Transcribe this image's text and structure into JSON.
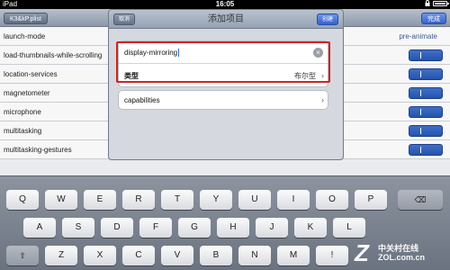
{
  "status_bar": {
    "carrier": "iPad",
    "time": "16:05",
    "wifi_icon": "wifi-icon",
    "lock_icon": "lock-icon",
    "battery_icon": "battery-icon"
  },
  "background_app": {
    "nav_back_label": "K3&kP.plist",
    "nav_done_label": "完成",
    "rows": [
      {
        "label": "launch-mode",
        "value": "pre-animate",
        "toggle": false
      },
      {
        "label": "load-thumbnails-while-scrolling",
        "value": "",
        "toggle": true
      },
      {
        "label": "location-services",
        "value": "",
        "toggle": true
      },
      {
        "label": "magnetometer",
        "value": "",
        "toggle": true
      },
      {
        "label": "microphone",
        "value": "",
        "toggle": true
      },
      {
        "label": "multitasking",
        "value": "",
        "toggle": true
      },
      {
        "label": "multitasking-gestures",
        "value": "",
        "toggle": true
      }
    ],
    "toggle_color": "#2f5fb9"
  },
  "modal": {
    "title": "添加项目",
    "cancel_label": "取消",
    "create_label": "创建",
    "key_field_value": "display-mirroring",
    "type_label": "类型",
    "type_value": "布尔型",
    "capabilities_label": "capabilities",
    "highlight_color": "#d32222"
  },
  "keyboard": {
    "row1": [
      "Q",
      "W",
      "E",
      "R",
      "T",
      "Y",
      "U",
      "I",
      "O",
      "P"
    ],
    "row2": [
      "A",
      "S",
      "D",
      "F",
      "G",
      "H",
      "J",
      "K",
      "L"
    ],
    "row3": [
      "Z",
      "X",
      "C",
      "V",
      "B",
      "N",
      "M",
      "!",
      "?"
    ]
  },
  "watermark": {
    "brand": "中关村在线",
    "url": "ZOL.com.cn"
  }
}
